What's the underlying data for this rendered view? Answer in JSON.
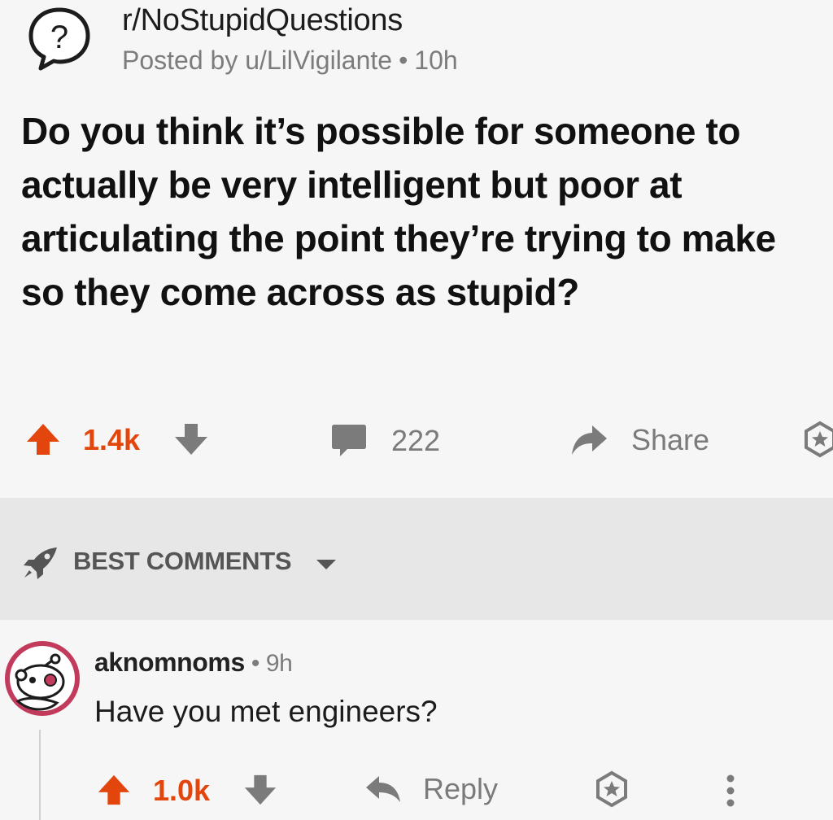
{
  "post": {
    "subreddit": "r/NoStupidQuestions",
    "posted_by": "Posted by u/LilVigilante",
    "time": "10h",
    "title": "Do you think it’s possible for someone to actually be very intelligent but poor at articulating the point they’re trying to make so they come across as stupid?",
    "score": "1.4k",
    "comments_count": "222",
    "share_label": "Share"
  },
  "sort": {
    "label": "BEST COMMENTS"
  },
  "comment": {
    "author": "aknomnoms",
    "time": "9h",
    "body": "Have you met engineers?",
    "score": "1.0k",
    "reply_label": "Reply"
  },
  "colors": {
    "upvote": "#e2460d",
    "text_gray": "#7c7c7c",
    "separator": "#e7e7e7",
    "avatar_ring": "#c23a5c"
  },
  "icons": [
    "question-bubble-icon",
    "upvote-arrow-icon",
    "downvote-arrow-icon",
    "comment-bubble-icon",
    "share-arrow-icon",
    "award-icon",
    "rocket-icon",
    "chevron-down-icon",
    "snoo-avatar-icon",
    "reply-arrow-icon",
    "more-options-icon"
  ]
}
